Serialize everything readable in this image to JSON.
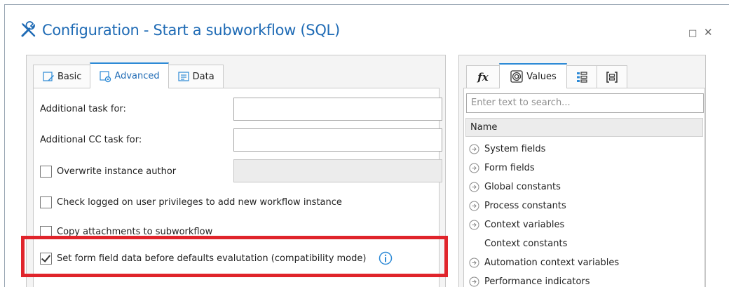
{
  "window": {
    "title": "Configuration - Start a subworkflow (SQL)",
    "maximize_glyph": "□",
    "close_glyph": "✕"
  },
  "left_tabs": [
    {
      "label": "Basic",
      "icon": "pencil-doc-icon",
      "active": false
    },
    {
      "label": "Advanced",
      "icon": "gear-doc-icon",
      "active": true
    },
    {
      "label": "Data",
      "icon": "list-doc-icon",
      "active": false
    }
  ],
  "advanced": {
    "additional_task_label": "Additional task for:",
    "additional_task_value": "",
    "additional_cc_label": "Additional CC task for:",
    "additional_cc_value": "",
    "overwrite_author_label": "Overwrite instance author",
    "overwrite_author_checked": false,
    "check_privileges_label": "Check logged on user privileges to add new workflow instance",
    "check_privileges_checked": false,
    "copy_attachments_label": "Copy attachments to subworkflow",
    "copy_attachments_checked": false,
    "set_form_field_label": "Set form field data before defaults evalutation (compatibility mode)",
    "set_form_field_checked": true
  },
  "right_tabs": [
    {
      "label": "fx",
      "icon": "function-icon",
      "active": false
    },
    {
      "label": "Values",
      "icon": "at-sign-icon",
      "active": true
    },
    {
      "label": "",
      "icon": "numbered-list-icon",
      "active": false
    },
    {
      "label": "",
      "icon": "bracket-list-icon",
      "active": false
    }
  ],
  "values_panel": {
    "search_placeholder": "Enter text to search...",
    "column_header": "Name",
    "items": [
      {
        "label": "System fields",
        "expandable": true
      },
      {
        "label": "Form fields",
        "expandable": true
      },
      {
        "label": "Global constants",
        "expandable": true
      },
      {
        "label": "Process constants",
        "expandable": true
      },
      {
        "label": "Context variables",
        "expandable": true
      },
      {
        "label": "Context constants",
        "expandable": false
      },
      {
        "label": "Automation context variables",
        "expandable": true
      },
      {
        "label": "Performance indicators",
        "expandable": true
      }
    ]
  },
  "colors": {
    "title_blue": "#1f6bb5",
    "tab_accent": "#2d8ad6",
    "highlight_red": "#e0242b"
  }
}
